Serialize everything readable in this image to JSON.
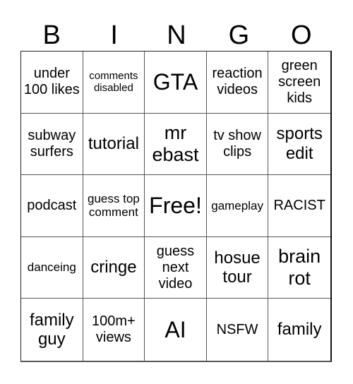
{
  "header": [
    "B",
    "I",
    "N",
    "G",
    "O"
  ],
  "cells": [
    "under 100 likes",
    "comments disabled",
    "GTA",
    "reaction videos",
    "green screen kids",
    "subway surfers",
    "tutorial",
    "mr ebast",
    "tv show clips",
    "sports edit",
    "podcast",
    "guess top comment",
    "Free!",
    "gameplay",
    "RACIST",
    "danceing",
    "cringe",
    "guess next video",
    "hosue tour",
    "brain rot",
    "family guy",
    "100m+ views",
    "AI",
    "NSFW",
    "family"
  ]
}
